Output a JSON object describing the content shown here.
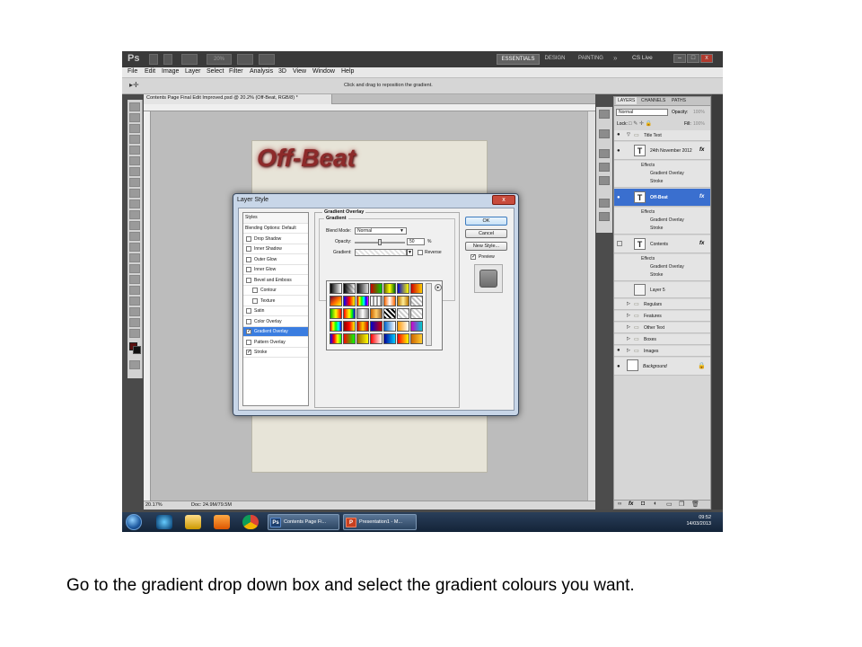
{
  "app": {
    "logo": "Ps",
    "workspaces": [
      "ESSENTIALS",
      "DESIGN",
      "PAINTING"
    ],
    "more_workspaces": "»",
    "cs_live": "CS Live",
    "zoom_field": "20%"
  },
  "menu": [
    "File",
    "Edit",
    "Image",
    "Layer",
    "Select",
    "Filter",
    "Analysis",
    "3D",
    "View",
    "Window",
    "Help"
  ],
  "options_bar": {
    "hint": "Click and drag to reposition the gradient."
  },
  "document": {
    "tab_title": "Contents Page Final Edit Improved.psd @ 20.2% (Off-Beat, RGB/8) *",
    "headline": "Off-Beat",
    "zoom": "20.17%",
    "doc_size": "Doc: 24.9M/79.5M"
  },
  "layers_panel": {
    "tabs": [
      "LAYERS",
      "CHANNELS",
      "PATHS"
    ],
    "blend_mode": "Normal",
    "opacity_label": "Opacity:",
    "opacity_value": "100%",
    "lock_label": "Lock:",
    "fill_label": "Fill:",
    "fill_value": "100%",
    "group_title": "Title Text",
    "layers": [
      {
        "name": "24th November 2012",
        "effects_label": "Effects",
        "effects": [
          "Gradient Overlay",
          "Stroke"
        ]
      },
      {
        "name": "Off-Beat",
        "selected": true,
        "effects_label": "Effects",
        "effects": [
          "Gradient Overlay",
          "Stroke"
        ]
      },
      {
        "name": "Contents",
        "effects_label": "Effects",
        "effects": [
          "Gradient Overlay",
          "Stroke"
        ]
      }
    ],
    "other_layers": [
      "Layer 5",
      "Regulars",
      "Features",
      "Other Text",
      "Boxes",
      "Images",
      "Background"
    ],
    "fx_label": "fx"
  },
  "dialog": {
    "title": "Layer Style",
    "close": "x",
    "styles_header": "Styles",
    "blending_options": "Blending Options: Default",
    "styles": [
      {
        "label": "Drop Shadow",
        "checked": false
      },
      {
        "label": "Inner Shadow",
        "checked": false
      },
      {
        "label": "Outer Glow",
        "checked": false
      },
      {
        "label": "Inner Glow",
        "checked": false
      },
      {
        "label": "Bevel and Emboss",
        "checked": false
      },
      {
        "label": "Contour",
        "checked": false
      },
      {
        "label": "Texture",
        "checked": false
      },
      {
        "label": "Satin",
        "checked": false
      },
      {
        "label": "Color Overlay",
        "checked": false
      },
      {
        "label": "Gradient Overlay",
        "checked": true,
        "selected": true
      },
      {
        "label": "Pattern Overlay",
        "checked": false
      },
      {
        "label": "Stroke",
        "checked": true
      }
    ],
    "section_title": "Gradient Overlay",
    "sub_title": "Gradient",
    "blend_mode_label": "Blend Mode:",
    "blend_mode_value": "Normal",
    "opacity_label": "Opacity:",
    "opacity_value": "50",
    "opacity_unit": "%",
    "gradient_label": "Gradient:",
    "reverse_label": "Reverse",
    "buttons": {
      "ok": "OK",
      "cancel": "Cancel",
      "new_style": "New Style..."
    },
    "preview_label": "Preview",
    "preview_checked": true
  },
  "taskbar": {
    "tasks": [
      {
        "icon": "Ps",
        "label": "Contents Page Fi..."
      },
      {
        "icon": "P",
        "label": "Presentation1 - M..."
      }
    ],
    "time": "09:52",
    "date": "14/03/2013"
  },
  "caption": "Go to the gradient drop down box and select the gradient colours you want."
}
